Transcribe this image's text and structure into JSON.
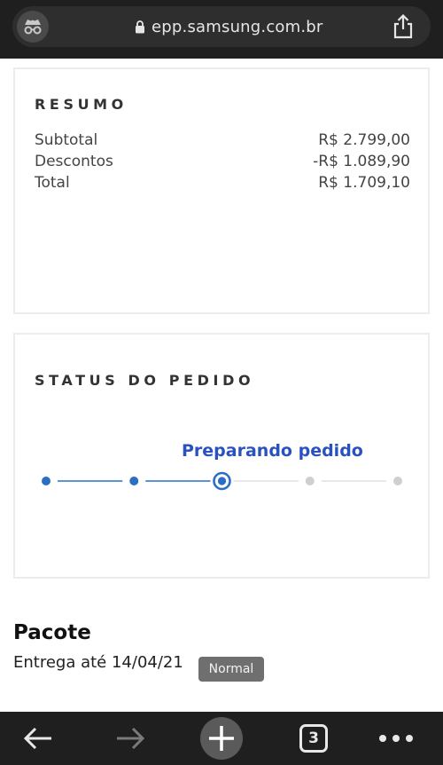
{
  "browser": {
    "url": "epp.samsung.com.br",
    "tab_count": "3"
  },
  "resumo": {
    "title": "RESUMO",
    "rows": [
      {
        "label": "Subtotal",
        "value": "R$ 2.799,00"
      },
      {
        "label": "Descontos",
        "value": "-R$ 1.089,90"
      },
      {
        "label": "Total",
        "value": "R$ 1.709,10"
      }
    ]
  },
  "status": {
    "title": "STATUS DO PEDIDO",
    "current_step_label": "Preparando pedido",
    "steps_total": 5,
    "current_step": 3,
    "colors": {
      "active": "#2a6fc4",
      "inactive": "#cfcfcf"
    }
  },
  "pacote": {
    "title": "Pacote",
    "entrega": "Entrega até 14/04/21",
    "badge": "Normal"
  }
}
